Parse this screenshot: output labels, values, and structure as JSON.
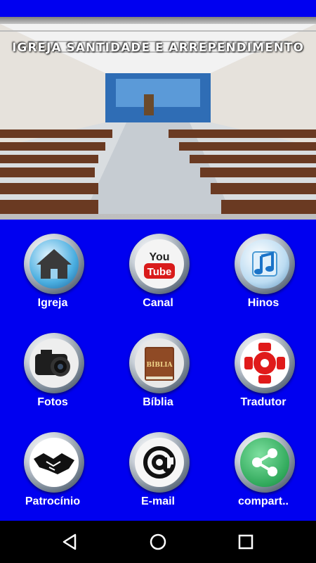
{
  "banner": {
    "title": "IGREJA SANTIDADE E ARREPENDIMENTO"
  },
  "menu": [
    {
      "label": "Igreja",
      "icon": "home-icon"
    },
    {
      "label": "Canal",
      "icon": "youtube-icon"
    },
    {
      "label": "Hinos",
      "icon": "music-note-icon"
    },
    {
      "label": "Fotos",
      "icon": "camera-icon"
    },
    {
      "label": "Bíblia",
      "icon": "bible-icon"
    },
    {
      "label": "Tradutor",
      "icon": "translator-icon"
    },
    {
      "label": "Patrocínio",
      "icon": "handshake-icon"
    },
    {
      "label": "E-mail",
      "icon": "at-sign-icon"
    },
    {
      "label": "compart..",
      "icon": "share-icon"
    }
  ],
  "icons": {
    "youtube_top": "You",
    "youtube_bottom": "Tube",
    "bible_text": "BÍBLIA"
  },
  "colors": {
    "background": "#0000f0",
    "label": "#ffffff",
    "nav_bar": "#000000"
  }
}
